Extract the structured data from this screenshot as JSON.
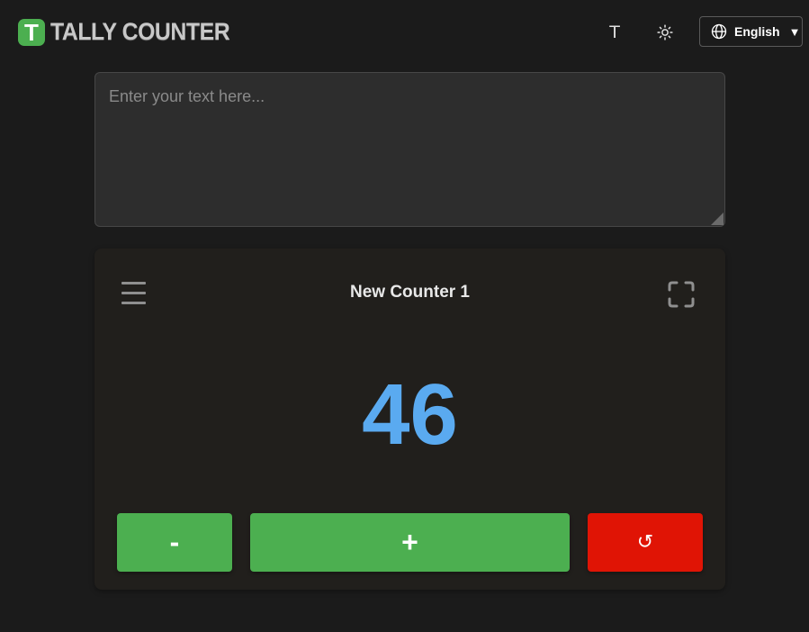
{
  "app": {
    "logo_letter": "T",
    "title": "TALLY COUNTER"
  },
  "header": {
    "font_button_label": "T",
    "theme_icon": "sun-icon",
    "language": {
      "icon": "globe-icon",
      "selected": "English",
      "caret": "▼"
    }
  },
  "text_input": {
    "placeholder": "Enter your text here...",
    "value": ""
  },
  "counter": {
    "menu_icon": "hamburger-menu-icon",
    "title": "New Counter 1",
    "fullscreen_icon": "fullscreen-icon",
    "value": "46",
    "decrement_label": "-",
    "increment_label": "+",
    "reset_label": "↺"
  },
  "colors": {
    "background": "#1b1b1b",
    "card": "#211f1c",
    "accent_green": "#4caf50",
    "reset_red": "#e01405",
    "counter_value": "#5aaaf0"
  }
}
